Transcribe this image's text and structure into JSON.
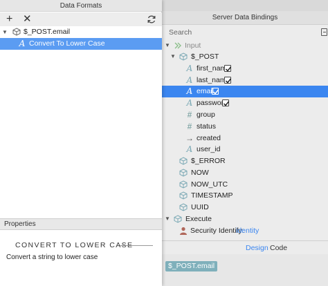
{
  "data_formats": {
    "title": "Data Formats",
    "toolbar": {
      "add_icon": "+",
      "delete_icon": "✕",
      "refresh_icon": "refresh-icon"
    },
    "tree": [
      {
        "label": "$_POST.email",
        "icon": "cube-icon",
        "expanded": true
      },
      {
        "label": "Convert To Lower Case",
        "icon": "text-format-icon",
        "selected": true
      }
    ],
    "properties": {
      "header": "Properties",
      "title": "CONVERT TO LOWER CASE",
      "description": "Convert a string to lower case"
    }
  },
  "server_data_bindings": {
    "title": "Server Data Bindings",
    "search_placeholder": "Search",
    "tree": {
      "input": {
        "label": "Input"
      },
      "post": {
        "label": "$_POST"
      },
      "fields": [
        {
          "label": "first_name",
          "type": "text",
          "checked": true
        },
        {
          "label": "last_name",
          "type": "text",
          "checked": true
        },
        {
          "label": "email",
          "type": "text",
          "checked": true,
          "selected": true
        },
        {
          "label": "password",
          "type": "text",
          "checked": true
        },
        {
          "label": "group",
          "type": "number"
        },
        {
          "label": "status",
          "type": "number"
        },
        {
          "label": "created",
          "type": "date"
        },
        {
          "label": "user_id",
          "type": "text"
        }
      ],
      "globals": [
        "$_ERROR",
        "NOW",
        "NOW_UTC",
        "TIMESTAMP",
        "UUID"
      ],
      "execute": {
        "label": "Execute"
      },
      "security": {
        "label": "Security Identify:",
        "value": "identity"
      }
    },
    "tabs": {
      "design": "Design",
      "code": "Code"
    },
    "binding": "$_POST.email"
  },
  "colors": {
    "selection": "#3b86f0",
    "text_icon": "#7aa8b4",
    "accent_link": "#3b86f0"
  }
}
